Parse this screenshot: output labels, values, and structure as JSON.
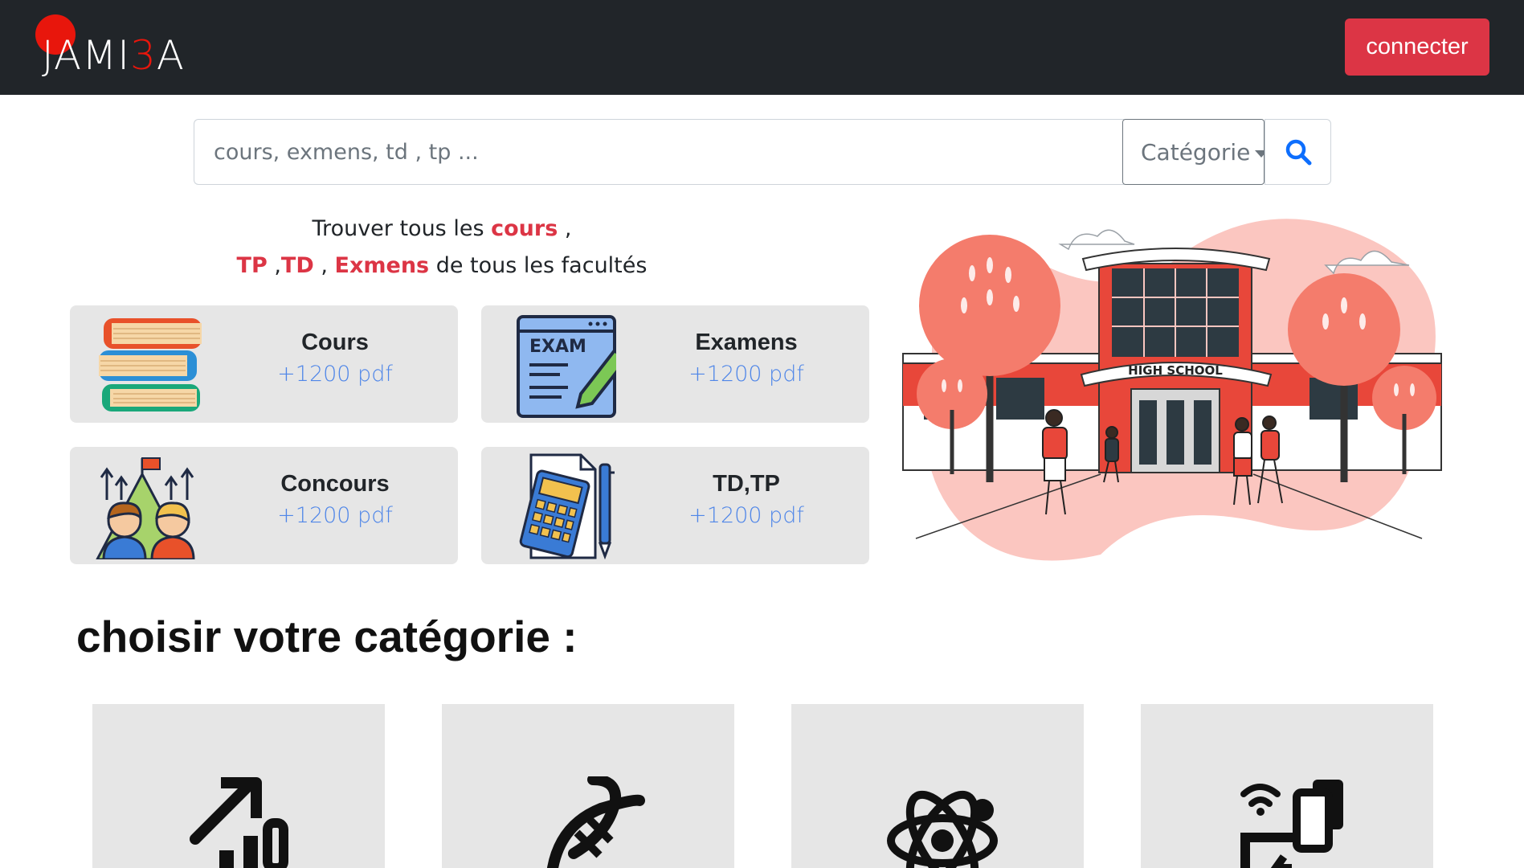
{
  "navbar": {
    "logo_prefix": "JAMI",
    "logo_highlight": "3",
    "logo_suffix": "A",
    "connect_label": "connecter"
  },
  "search": {
    "placeholder": "cours, exmens, td , tp ...",
    "category_label": "Catégorie",
    "search_icon": "search-icon"
  },
  "tagline": {
    "line1_prefix": "Trouver tous les ",
    "line1_highlight": "cours",
    "line1_suffix": " ,",
    "tp": "TP",
    "sep1": " ,",
    "td": "TD",
    "sep2": " , ",
    "exmens": "Exmens",
    "line2_suffix": " de tous les facultés"
  },
  "resources": [
    {
      "title": "Cours",
      "count": "+1200 pdf",
      "icon": "books-icon"
    },
    {
      "title": "Examens",
      "count": "+1200 pdf",
      "icon": "exam-icon"
    },
    {
      "title": "Concours",
      "count": "+1200 pdf",
      "icon": "contest-icon"
    },
    {
      "title": "TD,TP",
      "count": "+1200 pdf",
      "icon": "calculator-icon"
    }
  ],
  "illustration": {
    "sign_text": "HIGH SCHOOL"
  },
  "categories_section": {
    "title": "choisir votre catégorie :",
    "items": [
      {
        "icon": "growth-chart-icon"
      },
      {
        "icon": "dna-icon"
      },
      {
        "icon": "atom-icon"
      },
      {
        "icon": "devices-icon"
      }
    ]
  },
  "colors": {
    "navbar_bg": "#212529",
    "accent_red": "#dc3545",
    "link_blue": "#4f86e8",
    "card_bg": "#e6e6e6"
  }
}
